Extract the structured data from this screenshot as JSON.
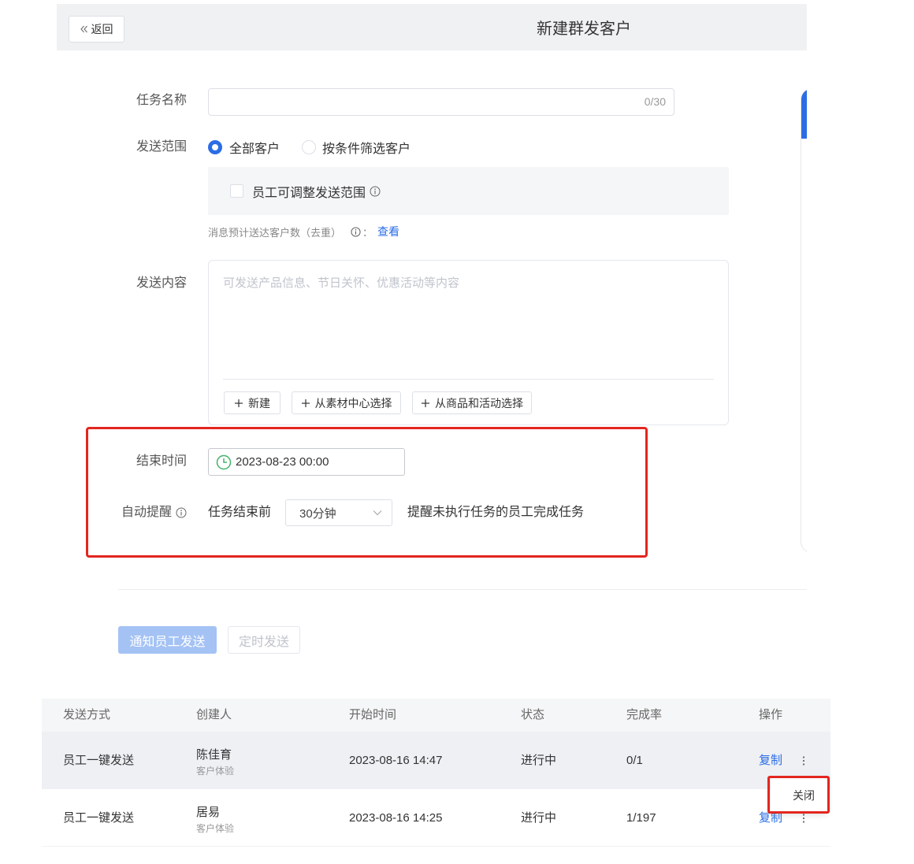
{
  "header": {
    "back_label": "返回",
    "title": "新建群发客户"
  },
  "form": {
    "task_name": {
      "label": "任务名称",
      "value": "",
      "counter": "0/30"
    },
    "send_scope": {
      "label": "发送范围",
      "options": [
        {
          "label": "全部客户",
          "selected": true
        },
        {
          "label": "按条件筛选客户",
          "selected": false
        }
      ],
      "adjustable": {
        "label": "员工可调整发送范围",
        "checked": false
      },
      "estimate_text": "消息预计送达客户数（去重）",
      "estimate_sep": "：",
      "estimate_link": "查看"
    },
    "content": {
      "label": "发送内容",
      "placeholder": "可发送产品信息、节日关怀、优惠活动等内容",
      "buttons": [
        "新建",
        "从素材中心选择",
        "从商品和活动选择"
      ]
    },
    "end_time": {
      "label": "结束时间",
      "value": "2023-08-23 00:00"
    },
    "auto_remind": {
      "label": "自动提醒",
      "prefix": "任务结束前",
      "selected": "30分钟",
      "suffix": "提醒未执行任务的员工完成任务"
    }
  },
  "actions": {
    "notify_label": "通知员工发送",
    "schedule_label": "定时发送"
  },
  "table": {
    "columns": [
      "发送方式",
      "创建人",
      "开始时间",
      "状态",
      "完成率",
      "操作"
    ],
    "rows": [
      {
        "method": "员工一键发送",
        "creator": "陈佳育",
        "creator_team": "客户体验",
        "start_time": "2023-08-16 14:47",
        "status": "进行中",
        "completion": "0/1",
        "action": "复制"
      },
      {
        "method": "员工一键发送",
        "creator": "居易",
        "creator_team": "客户体验",
        "start_time": "2023-08-16 14:25",
        "status": "进行中",
        "completion": "1/197",
        "action": "复制"
      }
    ]
  },
  "row_menu": {
    "close_label": "关闭"
  },
  "icons": {
    "back": "double-chevron-left-icon",
    "info": "info-icon",
    "add": "plus-icon",
    "date": "clock-icon",
    "select": "chevron-down-icon",
    "row_more": "more-vertical-icon"
  },
  "colors": {
    "accent": "#2b6de5",
    "accent_disabled": "#a4c2f4",
    "annotation": "#e3261f",
    "clock": "#43b36a",
    "header_bg": "#f0f1f3",
    "highlight_row": "#eef0f4"
  }
}
